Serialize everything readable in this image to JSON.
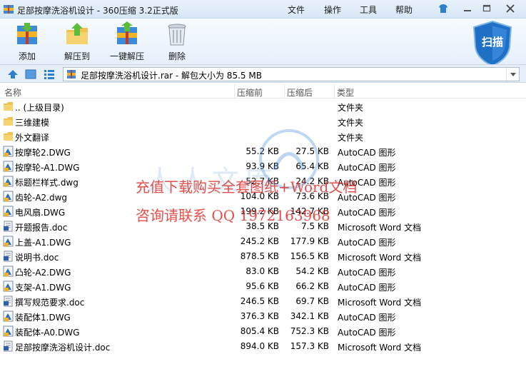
{
  "window": {
    "title": "足部按摩洗浴机设计 - 360压缩 3.2正式版",
    "menu": [
      "文件",
      "操作",
      "工具",
      "帮助"
    ]
  },
  "toolbar": {
    "buttons": [
      {
        "label": "添加",
        "icon": "add-archive-icon"
      },
      {
        "label": "解压到",
        "icon": "extract-to-icon"
      },
      {
        "label": "一键解压",
        "icon": "one-click-extract-icon"
      },
      {
        "label": "删除",
        "icon": "trash-icon"
      }
    ],
    "scan_label": "扫描"
  },
  "address": {
    "path": "足部按摩洗浴机设计.rar - 解包大小为 85.5 MB"
  },
  "columns": {
    "name": "名称",
    "size": "压缩前",
    "packed": "压缩后",
    "type": "类型"
  },
  "files": [
    {
      "name": ".. (上级目录)",
      "size": "",
      "packed": "",
      "type": "文件夹",
      "icon": "folder"
    },
    {
      "name": "三维建模",
      "size": "",
      "packed": "",
      "type": "文件夹",
      "icon": "folder"
    },
    {
      "name": "外文翻译",
      "size": "",
      "packed": "",
      "type": "文件夹",
      "icon": "folder"
    },
    {
      "name": "按摩轮2.DWG",
      "size": "55.2 KB",
      "packed": "27.5 KB",
      "type": "AutoCAD 图形",
      "icon": "dwg"
    },
    {
      "name": "按摩轮-A1.DWG",
      "size": "93.9 KB",
      "packed": "65.4 KB",
      "type": "AutoCAD 图形",
      "icon": "dwg"
    },
    {
      "name": "标题栏样式.dwg",
      "size": "52.7 KB",
      "packed": "24.2 KB",
      "type": "AutoCAD 图形",
      "icon": "dwg"
    },
    {
      "name": "齿轮-A2.dwg",
      "size": "104.0 KB",
      "packed": "73.6 KB",
      "type": "AutoCAD 图形",
      "icon": "dwg"
    },
    {
      "name": "电风扇.DWG",
      "size": "199.2 KB",
      "packed": "142.7 KB",
      "type": "AutoCAD 图形",
      "icon": "dwg"
    },
    {
      "name": "开题报告.doc",
      "size": "38.5 KB",
      "packed": "7.5 KB",
      "type": "Microsoft Word 文档",
      "icon": "doc"
    },
    {
      "name": "上盖-A1.DWG",
      "size": "245.2 KB",
      "packed": "177.9 KB",
      "type": "AutoCAD 图形",
      "icon": "dwg"
    },
    {
      "name": "说明书.doc",
      "size": "878.5 KB",
      "packed": "156.5 KB",
      "type": "Microsoft Word 文档",
      "icon": "doc"
    },
    {
      "name": "凸轮-A2.DWG",
      "size": "83.0 KB",
      "packed": "54.2 KB",
      "type": "AutoCAD 图形",
      "icon": "dwg"
    },
    {
      "name": "支架-A1.DWG",
      "size": "95.6 KB",
      "packed": "66.2 KB",
      "type": "AutoCAD 图形",
      "icon": "dwg"
    },
    {
      "name": "撰写规范要求.doc",
      "size": "246.5 KB",
      "packed": "69.7 KB",
      "type": "Microsoft Word 文档",
      "icon": "doc"
    },
    {
      "name": "装配体1.DWG",
      "size": "376.3 KB",
      "packed": "342.1 KB",
      "type": "AutoCAD 图形",
      "icon": "dwg"
    },
    {
      "name": "装配体-A0.DWG",
      "size": "805.4 KB",
      "packed": "752.3 KB",
      "type": "AutoCAD 图形",
      "icon": "dwg"
    },
    {
      "name": "足部按摩洗浴机设计.doc",
      "size": "894.0 KB",
      "packed": "157.3 KB",
      "type": "Microsoft Word 文档",
      "icon": "doc"
    }
  ],
  "watermark": {
    "line1": "充值下载购买全套图纸+Word文档",
    "line2": "咨询请联系 QQ 1972163968",
    "faint": "人人文库"
  },
  "colors": {
    "accent": "#2f7fd0",
    "watermark": "#e2302a",
    "folder": "#f2c14e"
  }
}
